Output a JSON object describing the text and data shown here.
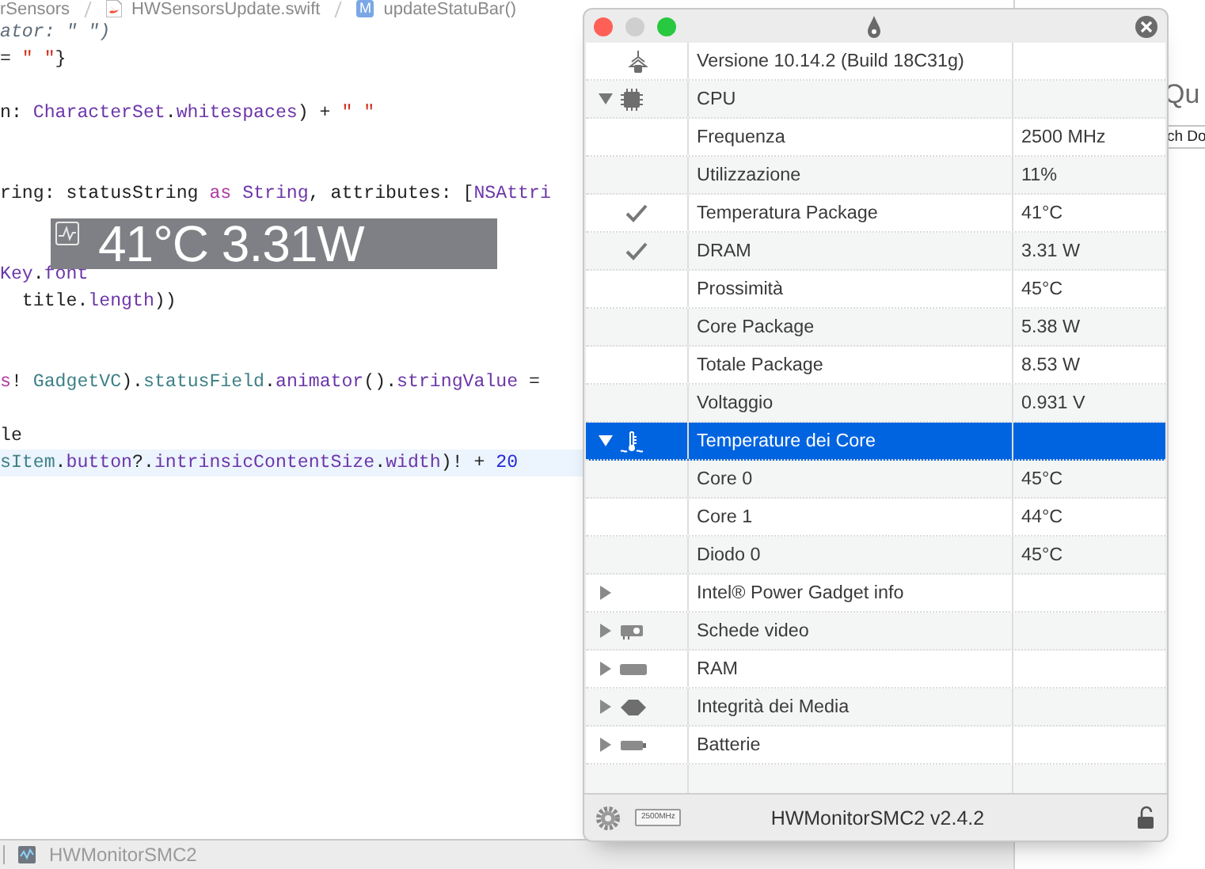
{
  "editor": {
    "breadcrumb": [
      {
        "text": "rSensors",
        "kind": "text"
      },
      {
        "text": "HWSensorsUpdate.swift",
        "kind": "file"
      },
      {
        "text": "updateStatuBar()",
        "kind": "method",
        "badge": "M"
      }
    ],
    "lines": [
      {
        "kind": "code",
        "current": false,
        "tokens": [
          {
            "text": "ator: \" \")",
            "kind": "hint"
          }
        ]
      },
      {
        "kind": "code",
        "current": false,
        "tokens": [
          {
            "text": "= ",
            "kind": "plain"
          },
          {
            "text": "\" \"",
            "kind": "string"
          },
          {
            "text": "}",
            "kind": "plain"
          }
        ]
      },
      {
        "kind": "blank"
      },
      {
        "kind": "code",
        "current": false,
        "tokens": [
          {
            "text": "n: ",
            "kind": "plain"
          },
          {
            "text": "CharacterSet",
            "kind": "type"
          },
          {
            "text": ".",
            "kind": "plain"
          },
          {
            "text": "whitespaces",
            "kind": "type"
          },
          {
            "text": ") + ",
            "kind": "plain"
          },
          {
            "text": "\" \"",
            "kind": "string"
          }
        ]
      },
      {
        "kind": "blank"
      },
      {
        "kind": "blank"
      },
      {
        "kind": "code",
        "current": false,
        "tokens": [
          {
            "text": "ring: statusString ",
            "kind": "plain"
          },
          {
            "text": "as ",
            "kind": "keyword"
          },
          {
            "text": "String",
            "kind": "type"
          },
          {
            "text": ", attributes: [",
            "kind": "plain"
          },
          {
            "text": "NSAttri",
            "kind": "type"
          }
        ]
      },
      {
        "kind": "blank"
      },
      {
        "kind": "blank"
      },
      {
        "kind": "code",
        "current": false,
        "tokens": [
          {
            "text": "Key",
            "kind": "type"
          },
          {
            "text": ".",
            "kind": "plain"
          },
          {
            "text": "font",
            "kind": "type"
          }
        ]
      },
      {
        "kind": "code",
        "current": false,
        "tokens": [
          {
            "text": "  title.",
            "kind": "plain"
          },
          {
            "text": "length",
            "kind": "type"
          },
          {
            "text": "))",
            "kind": "plain"
          }
        ]
      },
      {
        "kind": "blank"
      },
      {
        "kind": "blank"
      },
      {
        "kind": "code",
        "current": false,
        "tokens": [
          {
            "text": "s",
            "kind": "keyword"
          },
          {
            "text": "! ",
            "kind": "plain"
          },
          {
            "text": "GadgetVC",
            "kind": "project"
          },
          {
            "text": ").",
            "kind": "plain"
          },
          {
            "text": "statusField",
            "kind": "project"
          },
          {
            "text": ".",
            "kind": "plain"
          },
          {
            "text": "animator",
            "kind": "type"
          },
          {
            "text": "().",
            "kind": "plain"
          },
          {
            "text": "stringValue",
            "kind": "type"
          },
          {
            "text": " =",
            "kind": "plain"
          }
        ]
      },
      {
        "kind": "blank"
      },
      {
        "kind": "code",
        "current": false,
        "tokens": [
          {
            "text": "le",
            "kind": "plain"
          }
        ]
      },
      {
        "kind": "code",
        "current": true,
        "tokens": [
          {
            "text": "sItem",
            "kind": "project"
          },
          {
            "text": ".",
            "kind": "plain"
          },
          {
            "text": "button",
            "kind": "type"
          },
          {
            "text": "?.",
            "kind": "plain"
          },
          {
            "text": "intrinsicContentSize",
            "kind": "type"
          },
          {
            "text": ".",
            "kind": "plain"
          },
          {
            "text": "width",
            "kind": "type"
          },
          {
            "text": ")! + ",
            "kind": "plain"
          },
          {
            "text": "20",
            "kind": "number"
          }
        ]
      }
    ],
    "inspector": {
      "heading": "Qu",
      "field": "ch Do"
    },
    "bottom_bar": {
      "label": "HWMonitorSMC2"
    }
  },
  "status_item": {
    "text": "41°C 3.31W"
  },
  "monitor": {
    "tree": [
      {
        "kind": "version",
        "label": "Versione 10.14.2 (Build 18C31g)",
        "selected": false
      },
      {
        "kind": "cpu",
        "label": "CPU",
        "expanded": true,
        "selected": false,
        "children": [
          {
            "label": "Frequenza",
            "value": "2500 MHz",
            "checked": false,
            "selected": false
          },
          {
            "label": "Utilizzazione",
            "value": "11%",
            "checked": false,
            "selected": false
          },
          {
            "label": "Temperatura Package",
            "value": "41°C",
            "checked": true,
            "selected": false
          },
          {
            "label": "DRAM",
            "value": "3.31 W",
            "checked": true,
            "selected": false
          },
          {
            "label": "Prossimità",
            "value": "45°C",
            "checked": false,
            "selected": false
          },
          {
            "label": "Core Package",
            "value": "5.38 W",
            "checked": false,
            "selected": false
          },
          {
            "label": "Totale Package",
            "value": "8.53 W",
            "checked": false,
            "selected": false
          },
          {
            "label": "Voltaggio",
            "value": "0.931 V",
            "checked": false,
            "selected": false
          }
        ]
      },
      {
        "kind": "temperature",
        "label": "Temperature dei Core",
        "expanded": true,
        "selected": true,
        "children": [
          {
            "label": "Core 0",
            "value": "45°C",
            "checked": false,
            "selected": false
          },
          {
            "label": "Core 1",
            "value": "44°C",
            "checked": false,
            "selected": false
          },
          {
            "label": "Diodo 0",
            "value": "45°C",
            "checked": false,
            "selected": false
          }
        ]
      },
      {
        "kind": "info",
        "label": "Intel® Power Gadget info",
        "expanded": false,
        "selected": false
      },
      {
        "kind": "gpu",
        "label": "Schede video",
        "expanded": false,
        "selected": false
      },
      {
        "kind": "ram",
        "label": "RAM",
        "expanded": false,
        "selected": false
      },
      {
        "kind": "media",
        "label": "Integrità dei Media",
        "expanded": false,
        "selected": false
      },
      {
        "kind": "battery",
        "label": "Batterie",
        "expanded": false,
        "selected": false
      }
    ],
    "footer": {
      "badge": "2500MHz",
      "title": "HWMonitorSMC2 v2.4.2"
    }
  }
}
